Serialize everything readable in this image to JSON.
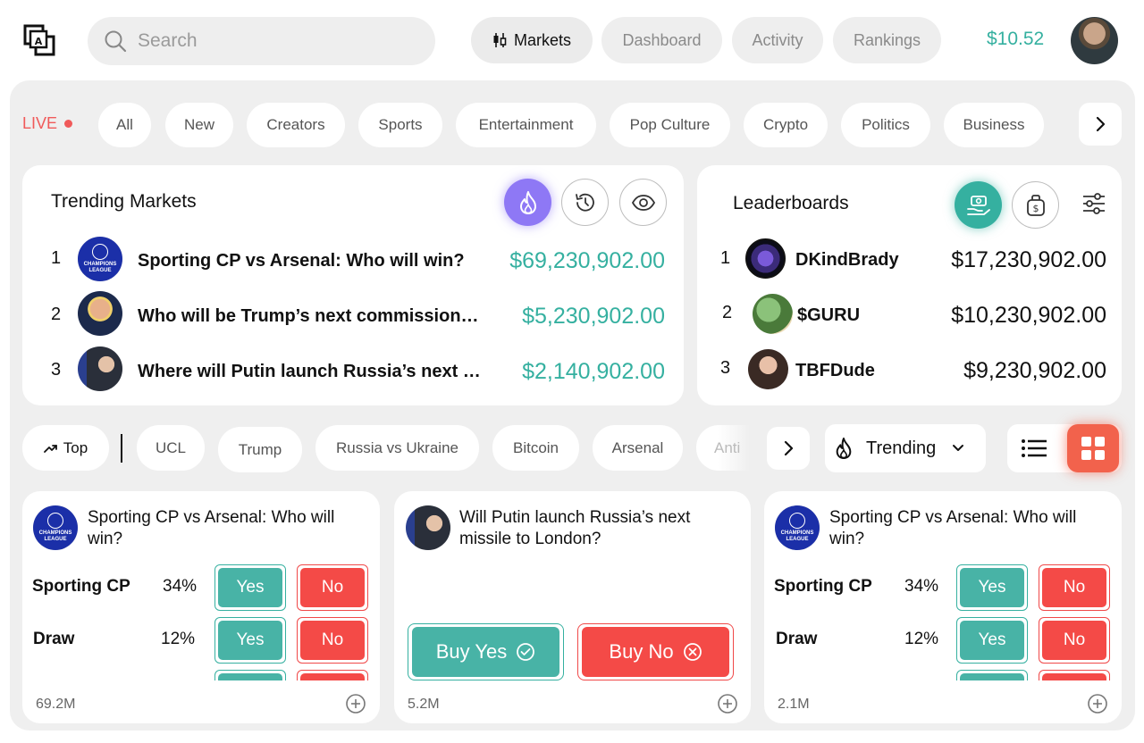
{
  "header": {
    "search_placeholder": "Search",
    "nav": [
      "Markets",
      "Dashboard",
      "Activity",
      "Rankings"
    ],
    "balance": "$10.52"
  },
  "categories": {
    "live_label": "LIVE",
    "items": [
      "All",
      "New",
      "Creators",
      "Sports",
      "Entertainment",
      "Pop Culture",
      "Crypto",
      "Politics",
      "Business"
    ]
  },
  "trending": {
    "title": "Trending Markets",
    "items": [
      {
        "rank": "1",
        "title": "Sporting CP vs Arsenal: Who will win?",
        "value": "$69,230,902.00",
        "avatar": "ucl-logo"
      },
      {
        "rank": "2",
        "title": "Who will be Trump’s next commissioner?",
        "value": "$5,230,902.00",
        "avatar": "trump-photo"
      },
      {
        "rank": "3",
        "title": "Where will Putin launch Russia’s next missile?",
        "value": "$2,140,902.00",
        "avatar": "putin-photo"
      }
    ]
  },
  "leaderboards": {
    "title": "Leaderboards",
    "items": [
      {
        "rank": "1",
        "name": "DKindBrady",
        "value": "$17,230,902.00"
      },
      {
        "rank": "2",
        "name": "$GURU",
        "value": "$10,230,902.00"
      },
      {
        "rank": "3",
        "name": "TBFDude",
        "value": "$9,230,902.00"
      }
    ]
  },
  "filters": {
    "top_label": "Top",
    "tags": [
      "UCL",
      "Trump",
      "Russia vs Ukraine",
      "Bitcoin",
      "Arsenal",
      "Anti"
    ],
    "sort_label": "Trending"
  },
  "markets": [
    {
      "title": "Sporting CP vs Arsenal:  Who will win?",
      "outcomes": [
        {
          "name": "Sporting CP",
          "pct": "34%"
        },
        {
          "name": "Draw",
          "pct": "12%"
        }
      ],
      "yes_label": "Yes",
      "no_label": "No",
      "volume": "69.2M"
    },
    {
      "title": "Will Putin launch Russia’s next missile to London?",
      "buy_yes": "Buy Yes",
      "buy_no": "Buy No",
      "volume": "5.2M"
    },
    {
      "title": "Sporting CP vs Arsenal:  Who will win?",
      "outcomes": [
        {
          "name": "Sporting CP",
          "pct": "34%"
        },
        {
          "name": "Draw",
          "pct": "12%"
        }
      ],
      "yes_label": "Yes",
      "no_label": "No",
      "volume": "2.1M"
    }
  ],
  "colors": {
    "accent_teal": "#35b0a0",
    "no_red": "#f44a47",
    "live_red": "#f05a5a",
    "grid_active": "#f2624c",
    "trending_purple": "#8e78f5"
  }
}
